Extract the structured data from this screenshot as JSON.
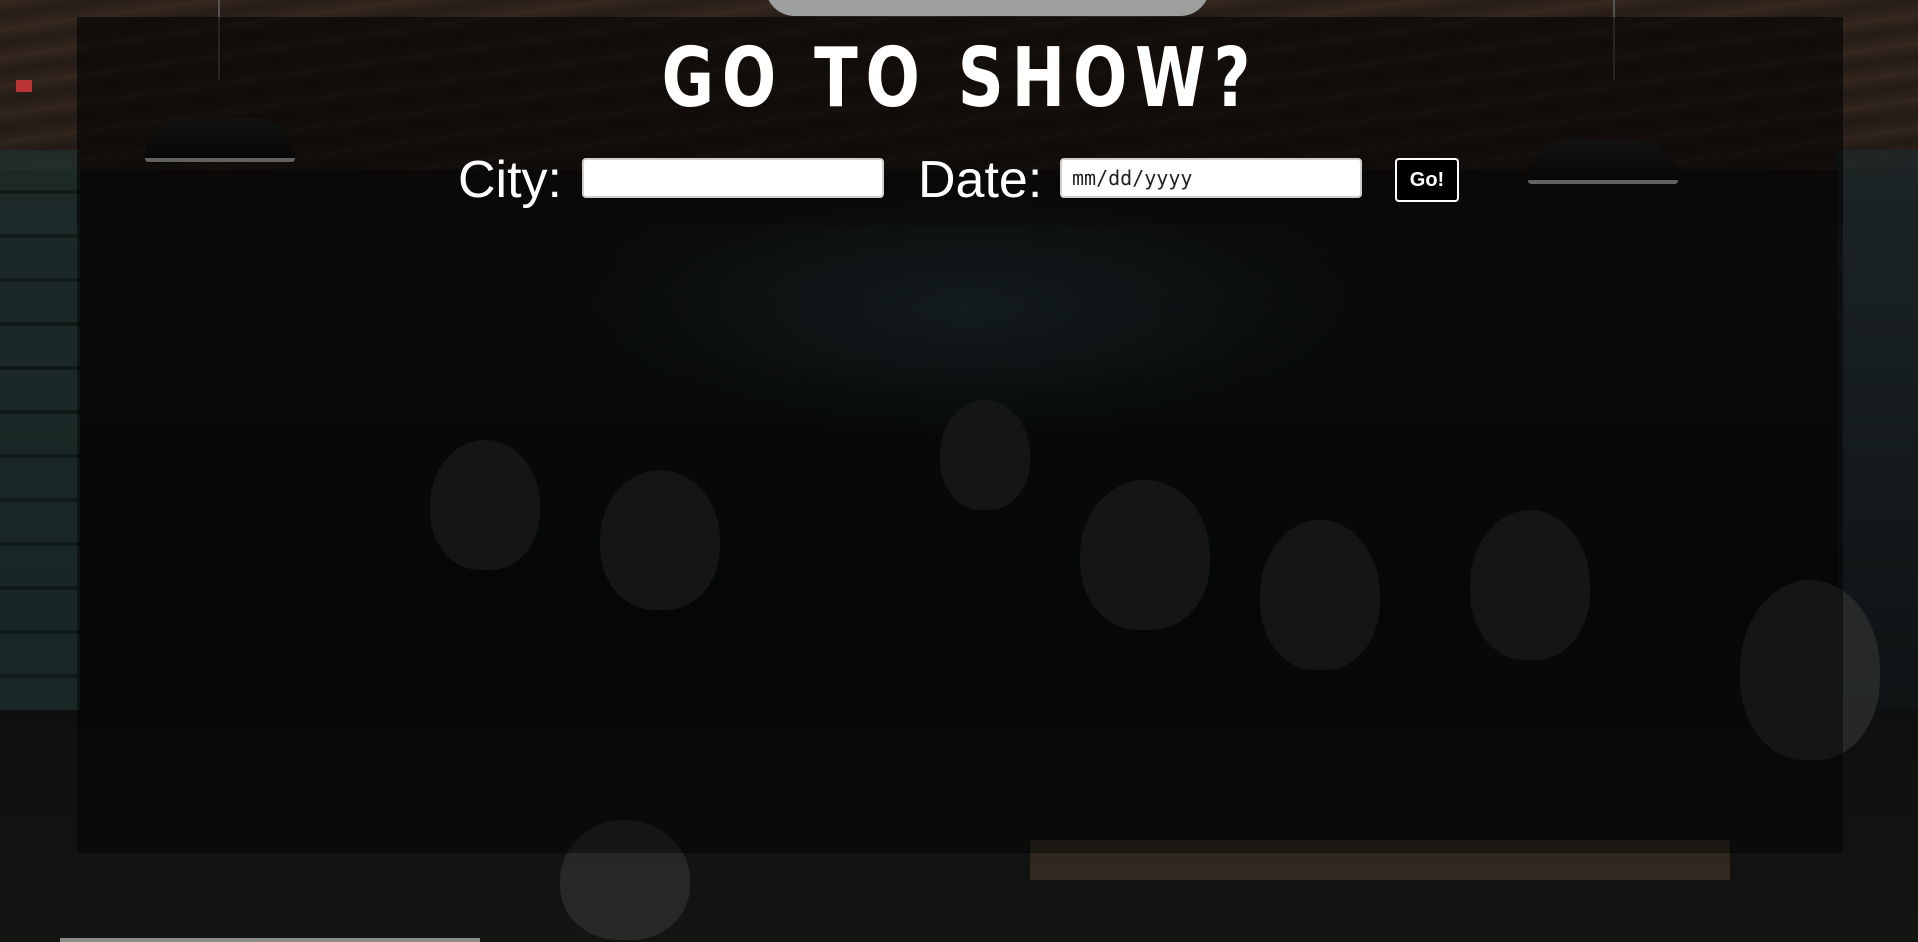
{
  "app": {
    "title": "GO TO SHOW?"
  },
  "search": {
    "city_label": "City:",
    "city_value": "",
    "date_label": "Date:",
    "date_placeholder": "mm/dd/yyyy",
    "submit_label": "Go!"
  },
  "results": {
    "items": []
  },
  "colors": {
    "overlay": "#000000",
    "text": "#ffffff",
    "input_background": "#ffffff",
    "button_background": "#000000"
  }
}
